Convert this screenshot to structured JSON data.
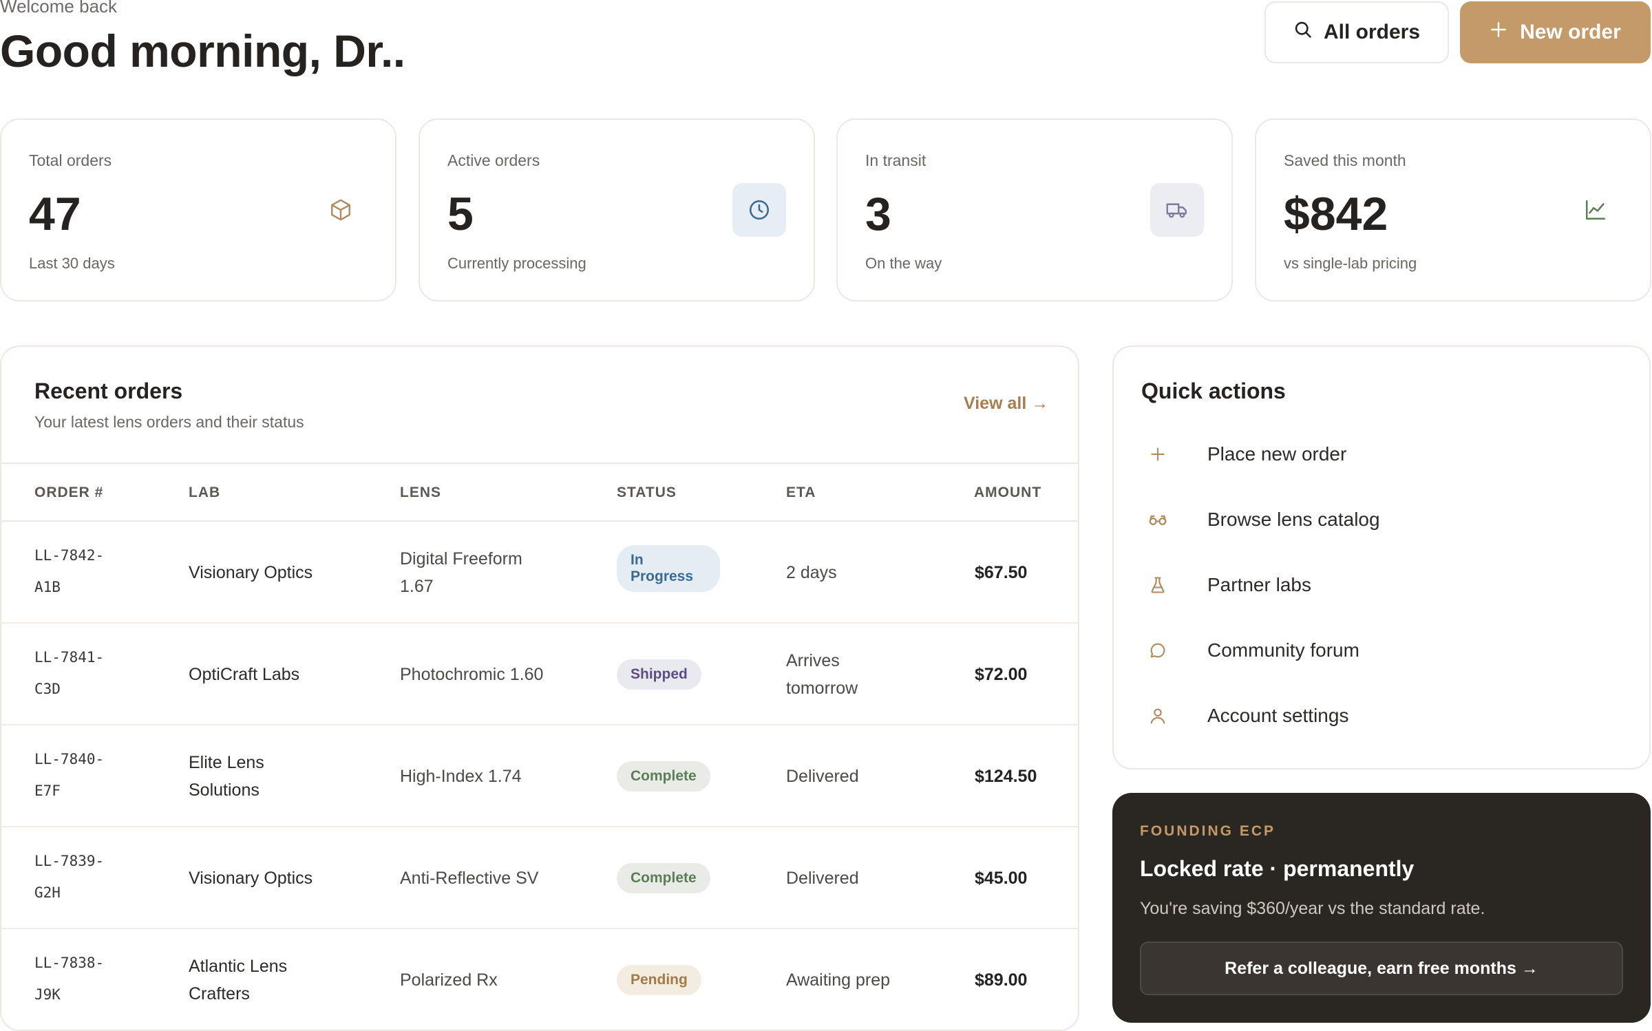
{
  "header": {
    "welcome": "Welcome back",
    "greeting": "Good morning, Dr..",
    "all_orders_label": "All orders",
    "new_order_label": "New order",
    "accent": "#c59a69"
  },
  "stats": [
    {
      "label": "Total orders",
      "value": "47",
      "sub": "Last 30 days",
      "icon": "box-icon"
    },
    {
      "label": "Active orders",
      "value": "5",
      "sub": "Currently processing",
      "icon": "clock-icon"
    },
    {
      "label": "In transit",
      "value": "3",
      "sub": "On the way",
      "icon": "truck-icon"
    },
    {
      "label": "Saved this month",
      "value": "$842",
      "sub": "vs single-lab pricing",
      "icon": "chart-line-icon"
    }
  ],
  "orders": {
    "title": "Recent orders",
    "description": "Your latest lens orders and their status",
    "view_all": "View all →",
    "columns": [
      "ORDER #",
      "LAB",
      "LENS",
      "STATUS",
      "ETA",
      "AMOUNT"
    ],
    "rows": [
      {
        "order_a": "LL-7842-",
        "order_b": "A1B",
        "lab_a": "Visionary Optics",
        "lab_b": "",
        "lens_a": "Digital Freeform",
        "lens_b": "1.67",
        "status_a": "In",
        "status_b": "Progress",
        "eta_a": "2 days",
        "eta_b": "",
        "amount": "$67.50"
      },
      {
        "order_a": "LL-7841-",
        "order_b": "C3D",
        "lab_a": "OptiCraft Labs",
        "lab_b": "",
        "lens_a": "Photochromic 1.60",
        "lens_b": "",
        "status_a": "Shipped",
        "status_b": "",
        "eta_a": "Arrives",
        "eta_b": "tomorrow",
        "amount": "$72.00"
      },
      {
        "order_a": "LL-7840-",
        "order_b": "E7F",
        "lab_a": "Elite Lens",
        "lab_b": "Solutions",
        "lens_a": "High-Index 1.74",
        "lens_b": "",
        "status_a": "Complete",
        "status_b": "",
        "eta_a": "Delivered",
        "eta_b": "",
        "amount": "$124.50"
      },
      {
        "order_a": "LL-7839-",
        "order_b": "G2H",
        "lab_a": "Visionary Optics",
        "lab_b": "",
        "lens_a": "Anti-Reflective SV",
        "lens_b": "",
        "status_a": "Complete",
        "status_b": "",
        "eta_a": "Delivered",
        "eta_b": "",
        "amount": "$45.00"
      },
      {
        "order_a": "LL-7838-",
        "order_b": "J9K",
        "lab_a": "Atlantic Lens",
        "lab_b": "Crafters",
        "lens_a": "Polarized Rx",
        "lens_b": "",
        "status_a": "Pending",
        "status_b": "",
        "eta_a": "Awaiting prep",
        "eta_b": "",
        "amount": "$89.00"
      }
    ],
    "status_colors": {
      "in_progress": "#3a6a92",
      "shipped": "#5e4d84",
      "complete": "#5b7e58",
      "pending": "#a47b46"
    }
  },
  "quick_actions": {
    "title": "Quick actions",
    "items": [
      {
        "label": "Place new order",
        "icon": "plus-icon"
      },
      {
        "label": "Browse lens catalog",
        "icon": "glasses-icon"
      },
      {
        "label": "Partner labs",
        "icon": "flask-icon"
      },
      {
        "label": "Community forum",
        "icon": "chat-bubble-icon"
      },
      {
        "label": "Account settings",
        "icon": "user-icon"
      }
    ]
  },
  "founding": {
    "tag": "FOUNDING ECP",
    "headline": "Locked rate · permanently",
    "note": "You're saving $360/year vs the standard rate.",
    "refer_label": "Refer a colleague, earn free months →"
  }
}
